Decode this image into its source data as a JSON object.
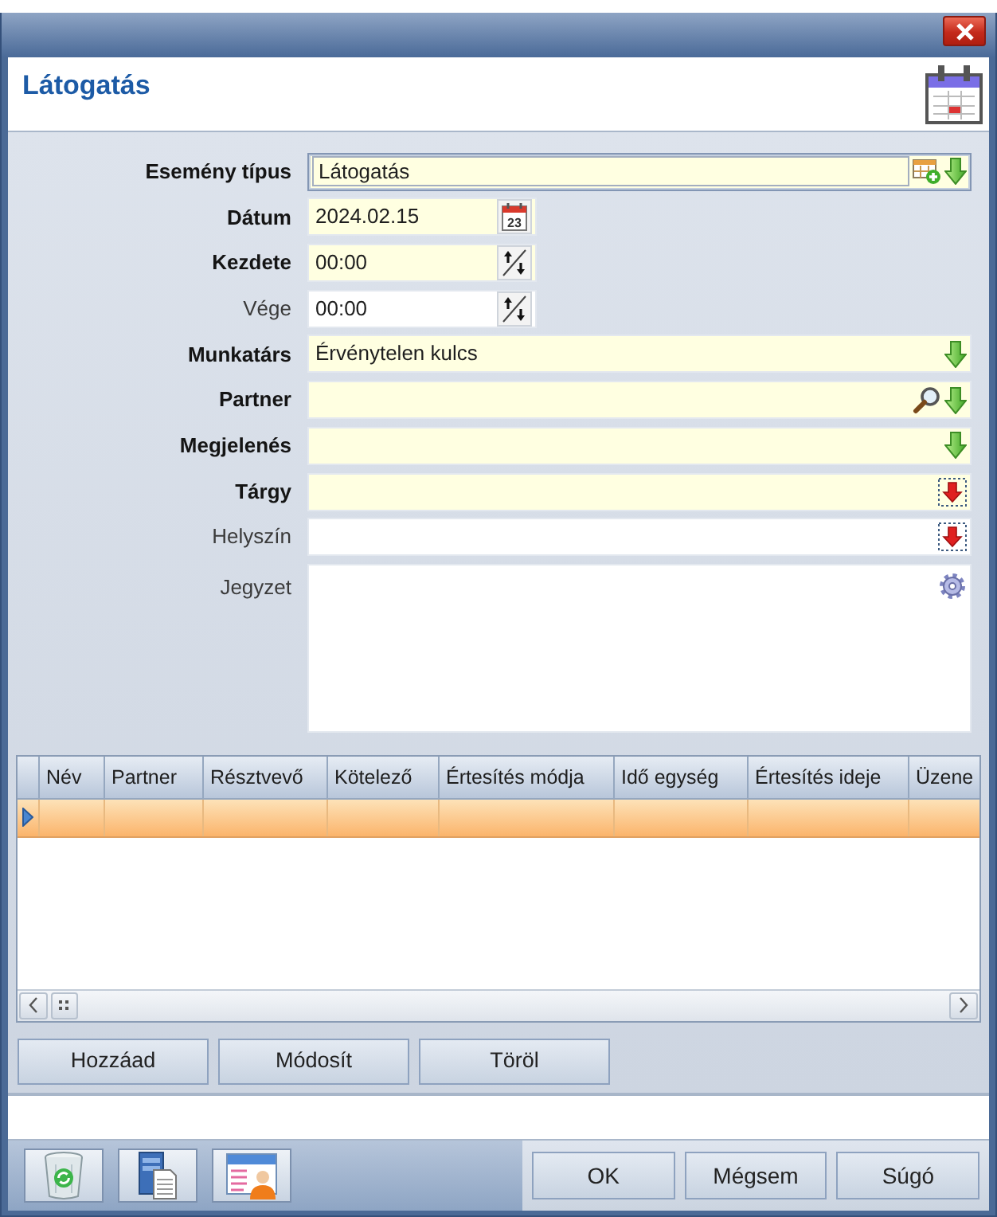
{
  "header": {
    "title": "Látogatás"
  },
  "fields": [
    {
      "label": "Esemény típus",
      "value": "Látogatás",
      "kind": "type_lookup",
      "required": true,
      "focused": true
    },
    {
      "label": "Dátum",
      "value": "2024.02.15",
      "kind": "date",
      "required": true,
      "focused": false,
      "calendar_day": "23"
    },
    {
      "label": "Kezdete",
      "value": "00:00",
      "kind": "time",
      "required": true,
      "focused": false
    },
    {
      "label": "Vége",
      "value": "00:00",
      "kind": "time",
      "required": false,
      "focused": false
    },
    {
      "label": "Munkatárs",
      "value": "Érvénytelen kulcs",
      "kind": "lookup",
      "required": true,
      "focused": false
    },
    {
      "label": "Partner",
      "kind": "search_lookup",
      "required": true,
      "focused": false
    },
    {
      "label": "Megjelenés",
      "kind": "lookup",
      "required": true,
      "focused": false
    },
    {
      "label": "Tárgy",
      "kind": "picker",
      "required": true,
      "focused": false
    },
    {
      "label": "Helyszín",
      "kind": "picker",
      "required": false,
      "focused": false
    },
    {
      "label": "Jegyzet",
      "kind": "memo",
      "required": false,
      "focused": false
    }
  ],
  "grid": {
    "columns": [
      "Név",
      "Partner",
      "Résztvevő",
      "Kötelező",
      "Értesítés módja",
      "Idő egység",
      "Értesítés ideje",
      "Üzene"
    ],
    "rows": [
      {
        "selected": true
      }
    ]
  },
  "grid_buttons": [
    "Hozzáad",
    "Módosít",
    "Töröl"
  ],
  "dialog_buttons": [
    "OK",
    "Mégsem",
    "Súgó"
  ]
}
